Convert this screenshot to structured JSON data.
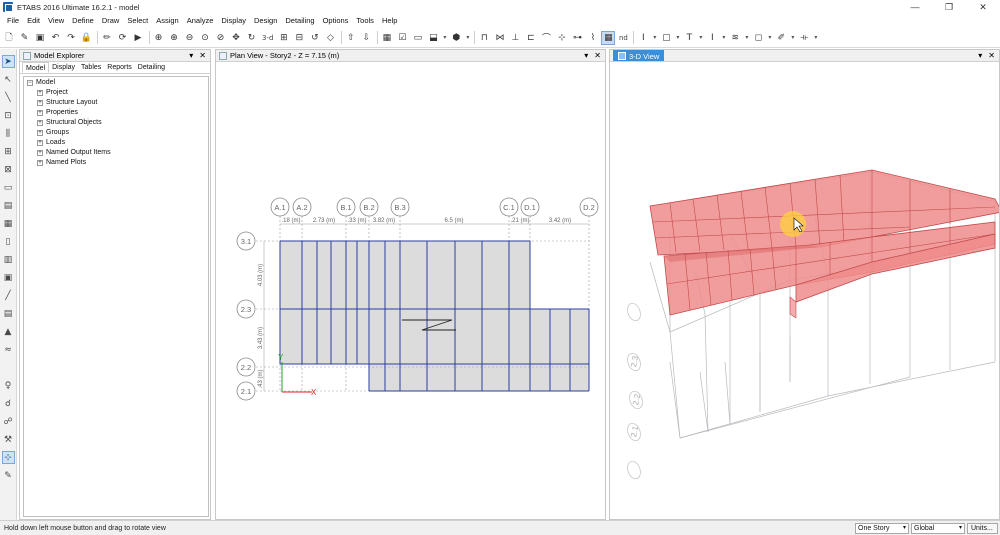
{
  "window": {
    "title": "ETABS 2016 Ultimate 16.2.1 - model",
    "controls": [
      "—",
      "❐",
      "✕"
    ]
  },
  "menu": [
    "File",
    "Edit",
    "View",
    "Define",
    "Draw",
    "Select",
    "Assign",
    "Analyze",
    "Display",
    "Design",
    "Detailing",
    "Options",
    "Tools",
    "Help"
  ],
  "toolbar": {
    "label_3d": "3-d",
    "label_nd": "nd"
  },
  "explorer": {
    "title": "Model Explorer",
    "tabs": [
      "Model",
      "Display",
      "Tables",
      "Reports",
      "Detailing"
    ],
    "root": "Model",
    "items": [
      "Project",
      "Structure Layout",
      "Properties",
      "Structural Objects",
      "Groups",
      "Loads",
      "Named Output Items",
      "Named Plots"
    ]
  },
  "plan_view": {
    "title": "Plan View - Story2 - Z = 7.15 (m)",
    "grid_x": [
      "A.1",
      "A.2",
      "B.1",
      "B.2",
      "B.3",
      "C.1",
      "D.1",
      "D.2"
    ],
    "grid_y": [
      "3.1",
      "2.3",
      "2.2",
      "2.1"
    ],
    "dims_x": [
      ".18 (m)",
      "2.73 (m)",
      ".33 (m)",
      "3.82 (m)",
      "6.5 (m)",
      ".21 (m)",
      "3.42 (m)"
    ],
    "dims_y": [
      "4.03 (m)",
      "3.43 (m)",
      ".43 (m)"
    ],
    "axis_x": "X",
    "axis_y": "Y"
  },
  "three_d_view": {
    "title": "3-D View",
    "grid_labels": [
      "2.3",
      "2.2",
      "2.1"
    ]
  },
  "status": {
    "message": "Hold down left mouse button and drag to rotate view",
    "story_option": "One Story",
    "coord_option": "Global",
    "units_button": "Units..."
  },
  "colors": {
    "slab_fill": "#f08c8c",
    "slab_stroke": "#c24a4a",
    "plan_fill": "#dcdcdc",
    "grid_blue": "#2a3fa0",
    "accent": "#3b8fd8",
    "cursor_highlight": "#ffd23c"
  }
}
